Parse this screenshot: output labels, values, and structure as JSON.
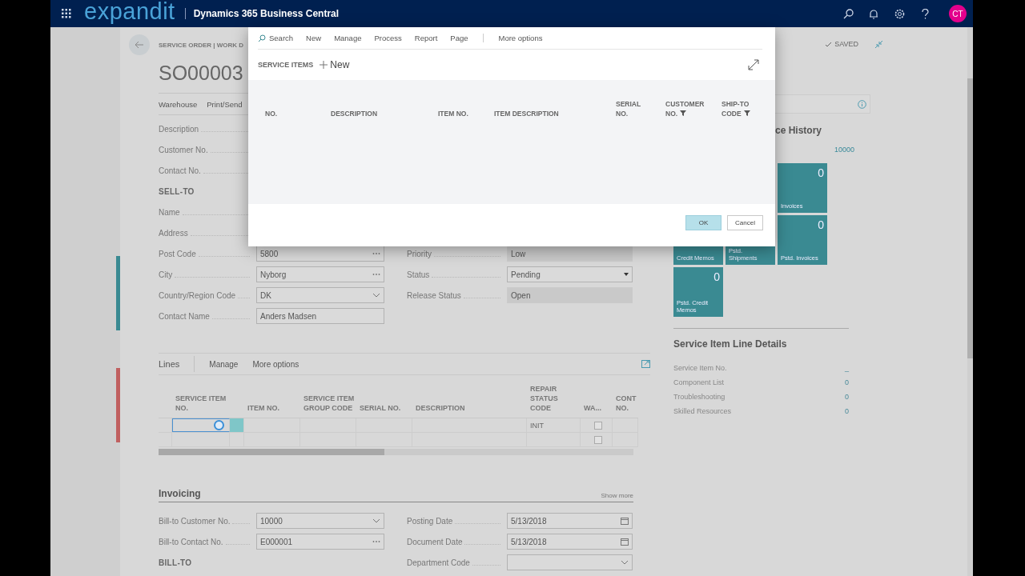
{
  "app_bar": {
    "brand": "expandit",
    "product": "Dynamics 365 Business Central",
    "avatar": "CT"
  },
  "page": {
    "breadcrumb": "SERVICE ORDER | WORK D",
    "title": "SO00003",
    "actions": [
      "Warehouse",
      "Print/Send"
    ],
    "saved": "SAVED"
  },
  "general": {
    "left": [
      {
        "kind": "label",
        "label": "Description"
      },
      {
        "kind": "label",
        "label": "Customer No."
      },
      {
        "kind": "label",
        "label": "Contact No."
      },
      {
        "kind": "heading",
        "label": "SELL-TO"
      },
      {
        "kind": "label",
        "label": "Name"
      },
      {
        "kind": "label",
        "label": "Address"
      },
      {
        "kind": "lookup",
        "label": "Post Code",
        "value": "5800"
      },
      {
        "kind": "lookup",
        "label": "City",
        "value": "Nyborg"
      },
      {
        "kind": "dropdown",
        "label": "Country/Region Code",
        "value": "DK"
      },
      {
        "kind": "text",
        "label": "Contact Name",
        "value": "Anders Madsen"
      }
    ],
    "right": [
      {
        "kind": "readonly",
        "label": "Priority",
        "value": "Low"
      },
      {
        "kind": "select",
        "label": "Status",
        "value": "Pending"
      },
      {
        "kind": "readonly",
        "label": "Release Status",
        "value": "Open"
      }
    ]
  },
  "lines": {
    "title": "Lines",
    "actions": [
      "Manage",
      "More options"
    ],
    "columns": [
      "SERVICE ITEM NO.",
      "",
      "ITEM NO.",
      "SERVICE ITEM GROUP CODE",
      "SERIAL NO.",
      "DESCRIPTION",
      "REPAIR STATUS CODE",
      "WA...",
      "CONT NO."
    ],
    "rows": [
      {
        "selected": true,
        "repair_status": "INIT",
        "waived": false
      },
      {
        "selected": false,
        "waived": false
      }
    ]
  },
  "invoicing": {
    "title": "Invoicing",
    "show_more": "Show more",
    "left": [
      {
        "kind": "dropdown",
        "label": "Bill-to Customer No.",
        "value": "10000"
      },
      {
        "kind": "lookup",
        "label": "Bill-to Contact No.",
        "value": "E000001"
      },
      {
        "kind": "heading",
        "label": "BILL-TO"
      }
    ],
    "right": [
      {
        "kind": "date",
        "label": "Posting Date",
        "value": "5/13/2018"
      },
      {
        "kind": "date",
        "label": "Document Date",
        "value": "5/13/2018"
      },
      {
        "kind": "dropdown",
        "label": "Department Code"
      }
    ]
  },
  "factbox": {
    "history_title": "ce History",
    "customer_no": "10000",
    "tiles": [
      {
        "count": "0",
        "label": "Invoices"
      },
      {
        "label": "Credit Memos"
      },
      {
        "label": "Pstd. Shipments"
      },
      {
        "count": "0",
        "label": "Pstd. Invoices"
      },
      {
        "count": "0",
        "label": "Pstd. Credit Memos"
      }
    ],
    "details": {
      "title": "Service Item Line Details",
      "rows": [
        {
          "label": "Service Item No.",
          "value": "_"
        },
        {
          "label": "Component List",
          "value": "0"
        },
        {
          "label": "Troubleshooting",
          "value": "0"
        },
        {
          "label": "Skilled Resources",
          "value": "0"
        }
      ]
    }
  },
  "dialog": {
    "toolbar": [
      {
        "kind": "search",
        "label": "Search"
      },
      {
        "kind": "action",
        "label": "New"
      },
      {
        "kind": "action",
        "label": "Manage"
      },
      {
        "kind": "action",
        "label": "Process"
      },
      {
        "kind": "action",
        "label": "Report"
      },
      {
        "kind": "action",
        "label": "Page"
      },
      {
        "kind": "more",
        "label": "More options"
      }
    ],
    "title": "SERVICE ITEMS",
    "new": "New",
    "columns": [
      {
        "label": "NO.",
        "filtered": false
      },
      {
        "label": "DESCRIPTION",
        "filtered": false
      },
      {
        "label": "ITEM NO.",
        "filtered": false
      },
      {
        "label": "ITEM DESCRIPTION",
        "filtered": false
      },
      {
        "label": "SERIAL NO.",
        "filtered": false
      },
      {
        "label": "CUSTOMER NO.",
        "filtered": true
      },
      {
        "label": "SHIP-TO CODE",
        "filtered": true
      }
    ],
    "buttons": [
      {
        "label": "OK",
        "primary": true
      },
      {
        "label": "Cancel",
        "primary": false
      }
    ]
  }
}
